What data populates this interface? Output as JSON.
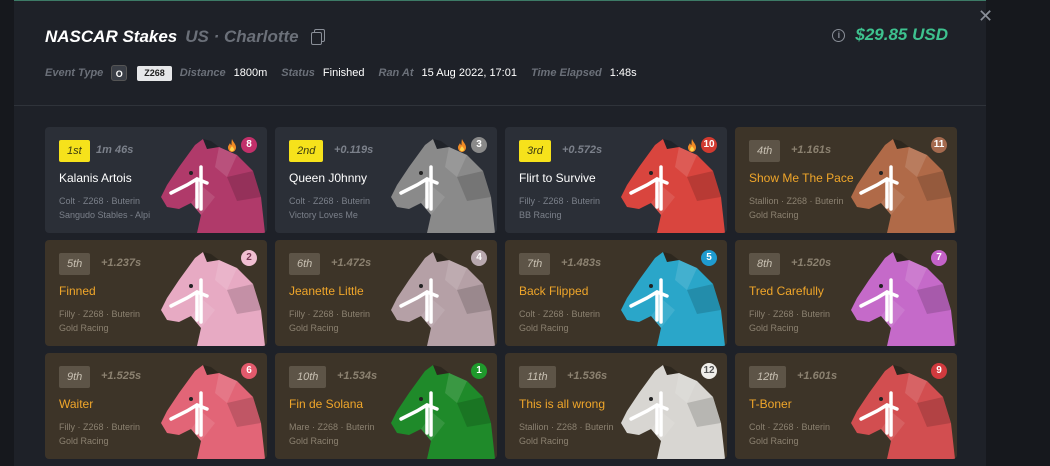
{
  "event": {
    "title": "NASCAR Stakes",
    "location": "US · Charlotte",
    "prize": "$29.85 USD",
    "event_type_label": "Event Type",
    "event_type_badge": "O",
    "class_badge": "Z268",
    "distance_label": "Distance",
    "distance": "1800m",
    "status_label": "Status",
    "status": "Finished",
    "ran_at_label": "Ran At",
    "ran_at": "15 Aug 2022, 17:01",
    "elapsed_label": "Time Elapsed",
    "elapsed": "1:48s"
  },
  "colors": {
    "accent": "#3ec28f",
    "podium": "#f6e21b",
    "name_orange": "#f0a62a"
  },
  "results": [
    {
      "pos": "1st",
      "time": "1m 46s",
      "name": "Kalanis Artois",
      "line1": "Colt · Z268 · Buterin",
      "line2": "Sangudo Stables - Alpi",
      "gate": "8",
      "horse_color": "#b03a6a",
      "badge_bg": "#c2306a",
      "badge_fg": "#ffffff",
      "fire": true
    },
    {
      "pos": "2nd",
      "time": "+0.119s",
      "name": "Queen J0hnny",
      "line1": "Colt · Z268 · Buterin",
      "line2": "Victory Loves Me",
      "gate": "3",
      "horse_color": "#8a8a8a",
      "badge_bg": "#8a8a8a",
      "badge_fg": "#ffffff",
      "fire": true
    },
    {
      "pos": "3rd",
      "time": "+0.572s",
      "name": "Flirt to Survive",
      "line1": "Filly · Z268 · Buterin",
      "line2": "BB Racing",
      "gate": "10",
      "horse_color": "#d9453e",
      "badge_bg": "#d23a30",
      "badge_fg": "#ffffff",
      "fire": true
    },
    {
      "pos": "4th",
      "time": "+1.161s",
      "name": "Show Me The Pace",
      "line1": "Stallion · Z268 · Buterin",
      "line2": "Gold Racing",
      "gate": "11",
      "horse_color": "#b06a48",
      "badge_bg": "#a56a4e",
      "badge_fg": "#ffffff",
      "fire": false
    },
    {
      "pos": "5th",
      "time": "+1.237s",
      "name": "Finned",
      "line1": "Filly · Z268 · Buterin",
      "line2": "Gold Racing",
      "gate": "2",
      "horse_color": "#e7aac3",
      "badge_bg": "#f1bfd2",
      "badge_fg": "#7a3a55",
      "fire": false
    },
    {
      "pos": "6th",
      "time": "+1.472s",
      "name": "Jeanette Little",
      "line1": "Filly · Z268 · Buterin",
      "line2": "Gold Racing",
      "gate": "4",
      "horse_color": "#b5a0a6",
      "badge_bg": "#b8a8ae",
      "badge_fg": "#ffffff",
      "fire": false
    },
    {
      "pos": "7th",
      "time": "+1.483s",
      "name": "Back Flipped",
      "line1": "Colt · Z268 · Buterin",
      "line2": "Gold Racing",
      "gate": "5",
      "horse_color": "#2aa6c9",
      "badge_bg": "#1f9bd0",
      "badge_fg": "#ffffff",
      "fire": false
    },
    {
      "pos": "8th",
      "time": "+1.520s",
      "name": "Tred Carefully",
      "line1": "Filly · Z268 · Buterin",
      "line2": "Gold Racing",
      "gate": "7",
      "horse_color": "#c56ac9",
      "badge_bg": "#c462c8",
      "badge_fg": "#ffffff",
      "fire": false
    },
    {
      "pos": "9th",
      "time": "+1.525s",
      "name": "Waiter",
      "line1": "Filly · Z268 · Buterin",
      "line2": "Gold Racing",
      "gate": "6",
      "horse_color": "#e26577",
      "badge_bg": "#e35a6c",
      "badge_fg": "#ffffff",
      "fire": false
    },
    {
      "pos": "10th",
      "time": "+1.534s",
      "name": "Fin de Solana",
      "line1": "Mare · Z268 · Buterin",
      "line2": "Gold Racing",
      "gate": "1",
      "horse_color": "#1f8a2a",
      "badge_bg": "#1f9a2c",
      "badge_fg": "#ffffff",
      "fire": false
    },
    {
      "pos": "11th",
      "time": "+1.536s",
      "name": "This is all wrong",
      "line1": "Stallion · Z268 · Buterin",
      "line2": "Gold Racing",
      "gate": "12",
      "horse_color": "#d8d6d2",
      "badge_bg": "#f0eeea",
      "badge_fg": "#555555",
      "fire": false
    },
    {
      "pos": "12th",
      "time": "+1.601s",
      "name": "T-Boner",
      "line1": "Colt · Z268 · Buterin",
      "line2": "Gold Racing",
      "gate": "9",
      "horse_color": "#d24e50",
      "badge_bg": "#d23a3e",
      "badge_fg": "#ffffff",
      "fire": false
    }
  ]
}
